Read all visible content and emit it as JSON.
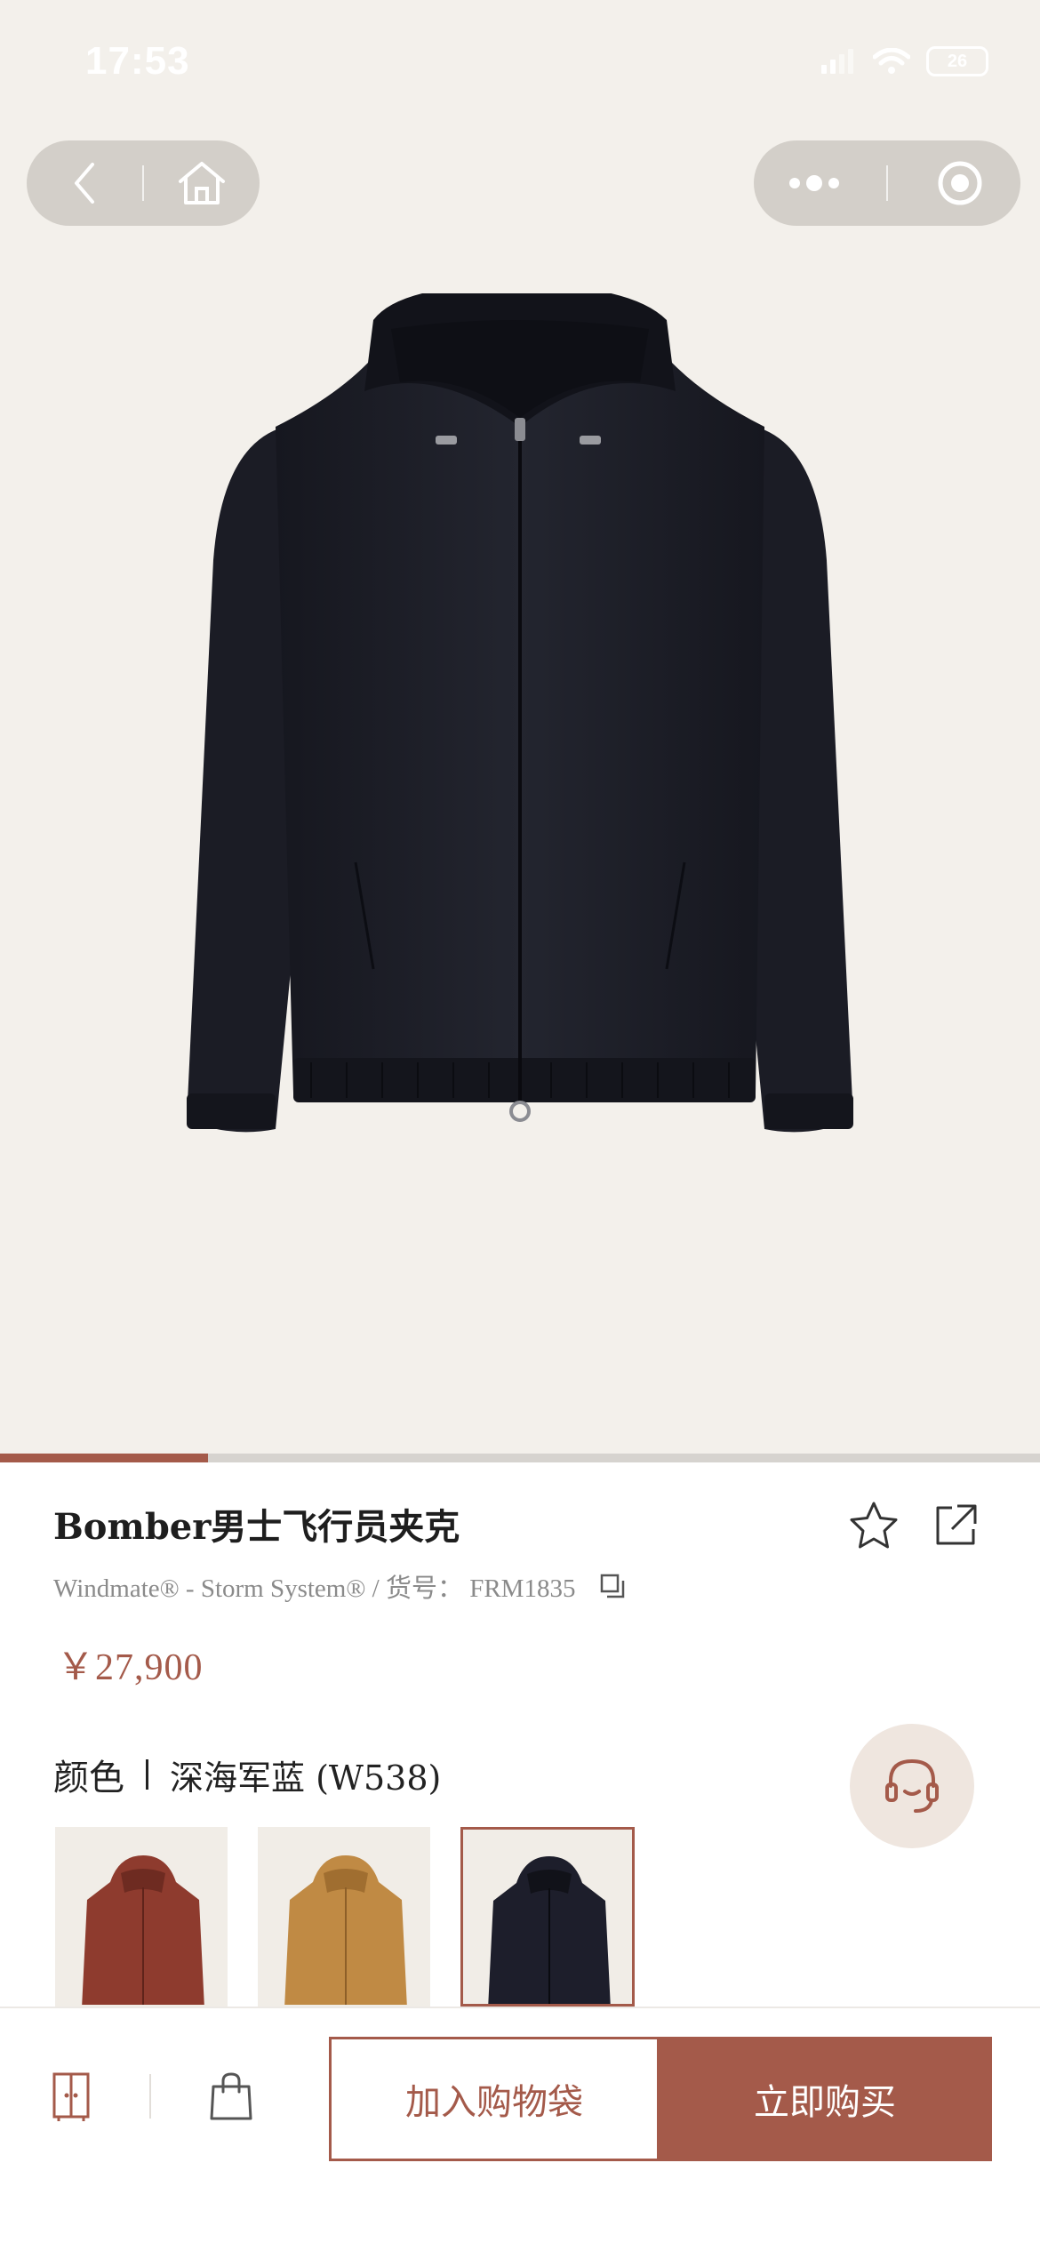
{
  "status_bar": {
    "time": "17:53",
    "battery": "26"
  },
  "nav": {
    "back_icon": "chevron-left-icon",
    "home_icon": "home-icon",
    "more_icon": "more-dots-icon",
    "close_icon": "capsule-target-icon"
  },
  "gallery": {
    "image": "navy-hooded-bomber-jacket",
    "progress": 0.2
  },
  "product": {
    "title": "Bomber男士飞行员夹克",
    "subtitle": "Windmate® - Storm System® / 货号： FRM1835",
    "price": "￥27,900"
  },
  "color": {
    "label": "颜色",
    "value": "深海军蓝 (W538)",
    "swatches": [
      {
        "name": "terracotta",
        "color": "#8e3b2e",
        "selected": false
      },
      {
        "name": "camel",
        "color": "#c08a44",
        "selected": false
      },
      {
        "name": "navy",
        "color": "#1d1e2b",
        "selected": true
      }
    ]
  },
  "colors": {
    "accent": "#a45a4a",
    "background": "#f3f0eb"
  },
  "bottom_bar": {
    "wardrobe_icon": "wardrobe-icon",
    "bag_icon": "shopping-bag-icon",
    "add_to_bag": "加入购物袋",
    "buy_now": "立即购买"
  }
}
